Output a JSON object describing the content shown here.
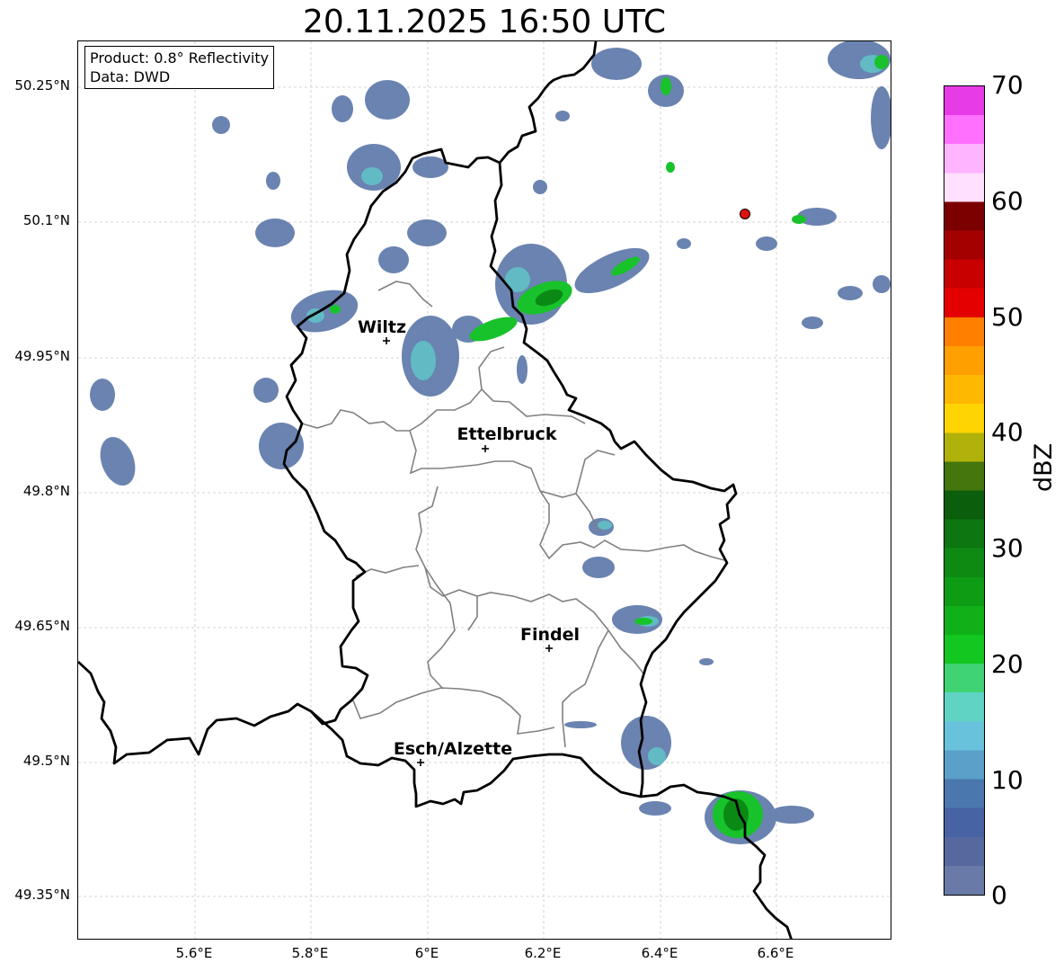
{
  "title": "20.11.2025 16:50 UTC",
  "info": {
    "product": "Product: 0.8° Reflectivity",
    "data": "Data: DWD"
  },
  "lat_ticks": [
    "50.25°N",
    "50.1°N",
    "49.95°N",
    "49.8°N",
    "49.65°N",
    "49.5°N",
    "49.35°N"
  ],
  "lon_ticks": [
    "5.6°E",
    "5.8°E",
    "6°E",
    "6.2°E",
    "6.4°E",
    "6.6°E"
  ],
  "cities": [
    {
      "name": "Wiltz",
      "lon": 5.93,
      "lat": 49.97
    },
    {
      "name": "Ettelbruck",
      "lon": 6.1,
      "lat": 49.85
    },
    {
      "name": "Findel",
      "lon": 6.21,
      "lat": 49.627
    },
    {
      "name": "Esch/Alzette",
      "lon": 5.99,
      "lat": 49.5
    }
  ],
  "radar_site": {
    "lon": 6.55,
    "lat": 50.11,
    "color": "#e01010"
  },
  "colorbar": {
    "label": "dBZ",
    "ticks": [
      "0",
      "10",
      "20",
      "30",
      "40",
      "50",
      "60",
      "70"
    ],
    "colors": [
      "#6a7aa8",
      "#56699f",
      "#4863a3",
      "#4a78ae",
      "#5aa0c8",
      "#68c2dc",
      "#60d3c5",
      "#3fd373",
      "#12c71f",
      "#10b018",
      "#0f9c15",
      "#0e8a13",
      "#0d7610",
      "#0a5e0c",
      "#45750d",
      "#b0b10a",
      "#ffd400",
      "#ffb800",
      "#ff9f00",
      "#ff7f00",
      "#e40000",
      "#c80000",
      "#a40000",
      "#7c0000",
      "#ffe0ff",
      "#ffb4ff",
      "#ff70ff",
      "#e73be7"
    ]
  },
  "chart_data": {
    "type": "heatmap",
    "title": "20.11.2025 16:50 UTC",
    "xlabel": "",
    "ylabel": "",
    "x_ticks": [
      "5.6°E",
      "5.8°E",
      "6°E",
      "6.2°E",
      "6.4°E",
      "6.6°E"
    ],
    "y_ticks": [
      "50.25°N",
      "50.1°N",
      "49.95°N",
      "49.8°N",
      "49.65°N",
      "49.5°N",
      "49.35°N"
    ],
    "colorbar_label": "dBZ",
    "colorbar_range": [
      0,
      70
    ],
    "grid": true
  }
}
